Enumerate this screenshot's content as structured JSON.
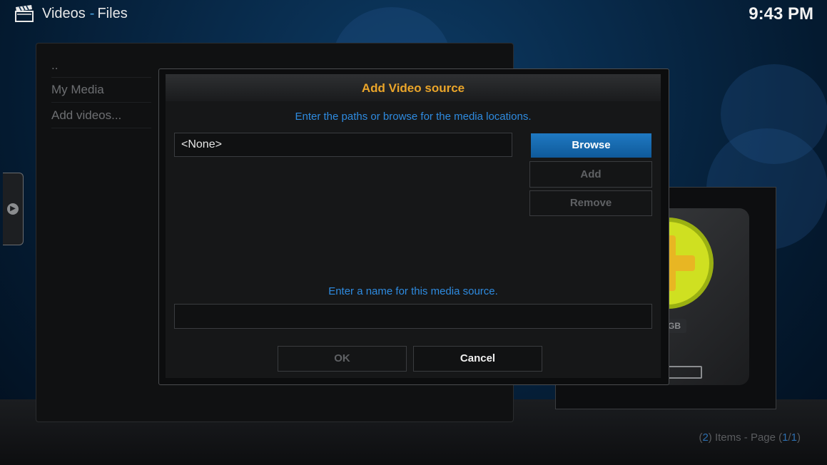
{
  "header": {
    "title": "Videos",
    "separator": "-",
    "subtitle": "Files",
    "icon": "clapperboard-icon",
    "clock": "9:43 PM"
  },
  "file_list": {
    "items": [
      {
        "label": ".."
      },
      {
        "label": "My Media"
      },
      {
        "label": "Add videos..."
      }
    ]
  },
  "thumbnail": {
    "drive_label": "GB"
  },
  "items_info": {
    "open1": "(",
    "count": "2",
    "mid": ") Items - Page (",
    "page": "1",
    "slash": "/",
    "total": "1",
    "close": ")"
  },
  "dialog": {
    "title": "Add Video source",
    "path_instruction": "Enter the paths or browse for the media locations.",
    "path_value": "<None>",
    "name_instruction": "Enter a name for this media source.",
    "name_value": "",
    "buttons": {
      "browse": "Browse",
      "add": "Add",
      "remove": "Remove",
      "ok": "OK",
      "cancel": "Cancel"
    }
  },
  "colors": {
    "accent_blue": "#2e8be0",
    "title_orange": "#eaa52a",
    "focus_blue": "#1f79c2"
  }
}
